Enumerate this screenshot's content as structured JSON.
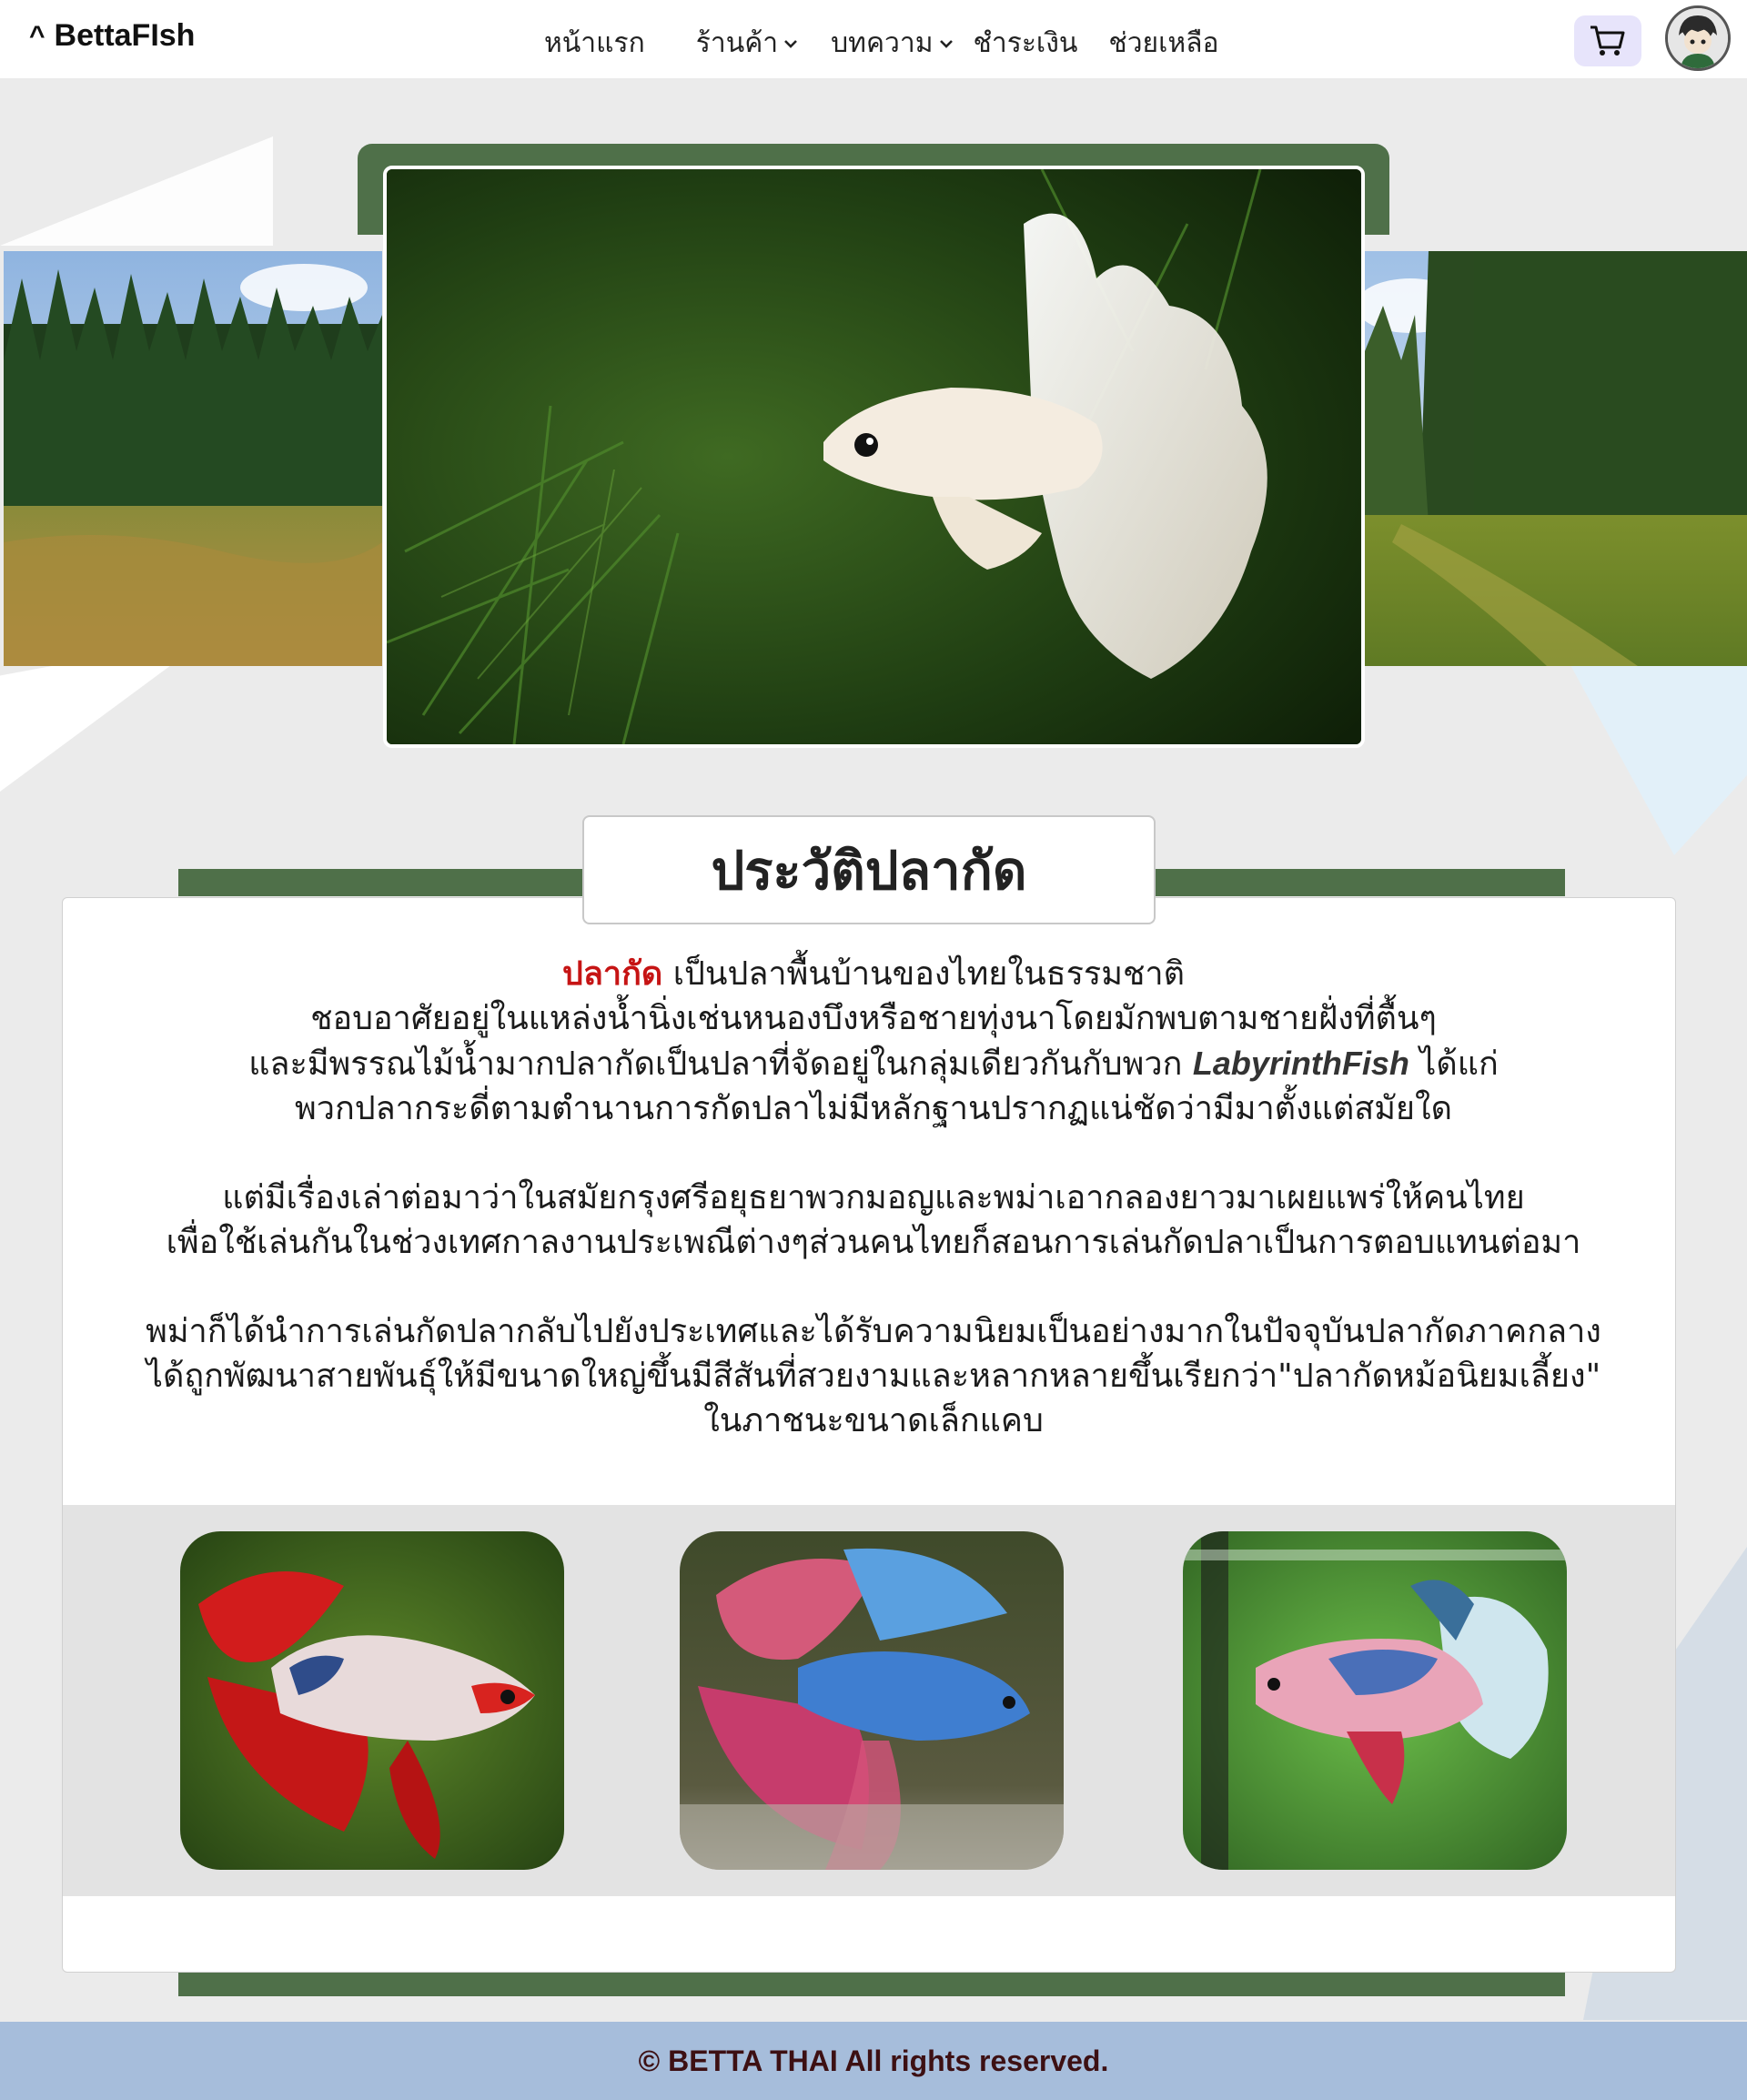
{
  "brand": {
    "caret": "^",
    "name": "BettaFIsh"
  },
  "nav": {
    "home": "หน้าแรก",
    "shop": "ร้านค้า",
    "articles": "บทความ",
    "payment": "ชำระเงิน",
    "help": "ช่วยเหลือ"
  },
  "icons": {
    "cart": "cart-icon",
    "avatar": "avatar",
    "chevron": "chevron-down-icon"
  },
  "colors": {
    "accent_green": "#4f7049",
    "highlight_red": "#c61414",
    "cart_bg": "#e7e4fb",
    "footer_bg": "#a6bddb",
    "footer_text": "#3d1013"
  },
  "history": {
    "title": "ประวัติปลากัด",
    "p1": {
      "highlight": "ปลากัด",
      "line1_rest": " เป็นปลาพื้นบ้านของไทยในธรรมชาติ",
      "line2": "ชอบอาศัยอยู่ในแหล่งน้ำนิ่งเช่นหนองบึงหรือชายทุ่งนาโดยมักพบตามชายฝั่งที่ตื้นๆ",
      "line3_before": "และมีพรรณไม้น้ำมากปลากัดเป็นปลาที่จัดอยู่ในกลุ่มเดียวกันกับพวก ",
      "line3_italic": "LabyrinthFish",
      "line3_after": " ได้แก่",
      "line4": "พวกปลากระดี่ตามตำนานการกัดปลาไม่มีหลักฐานปรากฏแน่ชัดว่ามีมาตั้งแต่สมัยใด"
    },
    "p2": {
      "line1": "แต่มีเรื่องเล่าต่อมาว่าในสมัยกรุงศรีอยุธยาพวกมอญและพม่าเอากลองยาวมาเผยแพร่ให้คนไทย",
      "line2": "เพื่อใช้เล่นกันในช่วงเทศกาลงานประเพณีต่างๆส่วนคนไทยก็สอนการเล่นกัดปลาเป็นการตอบแทนต่อมา"
    },
    "p3": {
      "line1": "พม่าก็ได้นำการเล่นกัดปลากลับไปยังประเทศและได้รับความนิยมเป็นอย่างมากในปัจจุบันปลากัดภาคกลาง",
      "line2": "ได้ถูกพัฒนาสายพันธุ์ให้มีขนาดใหญ่ขึ้นมีสีสันที่สวยงามและหลากหลายขึ้นเรียกว่า\"ปลากัดหม้อนิยมเลี้ยง\"",
      "line3": "ในภาชนะขนาดเล็กแคบ"
    }
  },
  "footer": {
    "text": "© BETTA THAI All rights reserved."
  }
}
